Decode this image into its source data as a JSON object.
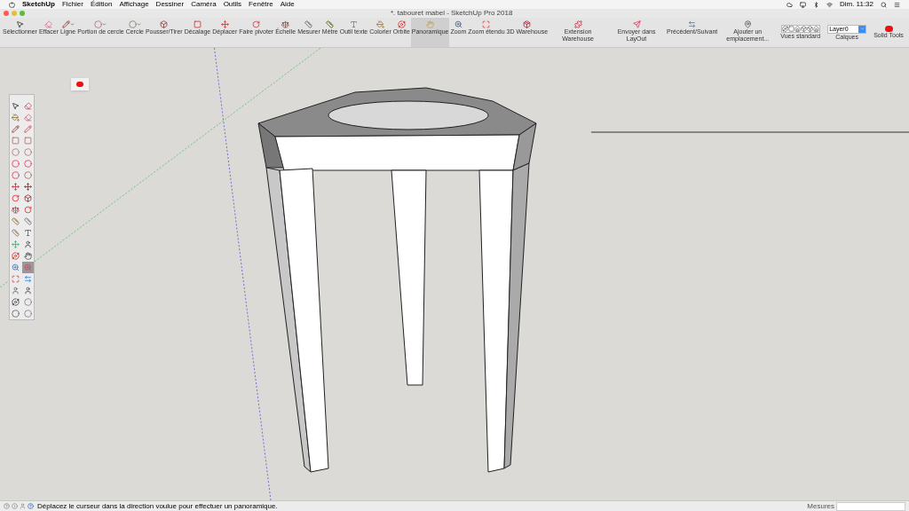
{
  "menu_bar": {
    "app": "SketchUp",
    "menus": [
      "Fichier",
      "Édition",
      "Affichage",
      "Dessiner",
      "Caméra",
      "Outils",
      "Fenêtre",
      "Aide"
    ],
    "clock": "Dim. 11:32"
  },
  "window": {
    "title": "*. tabouret mabel - SketchUp Pro 2018"
  },
  "toolbar": [
    {
      "label": "Sélectionner",
      "selected": false,
      "has_menu": false
    },
    {
      "label": "Effacer",
      "selected": false,
      "has_menu": false
    },
    {
      "label": "Ligne",
      "selected": false,
      "has_menu": true
    },
    {
      "label": "Portion de cercle",
      "selected": false,
      "has_menu": true
    },
    {
      "label": "Cercle",
      "selected": false,
      "has_menu": true
    },
    {
      "label": "Pousser/Tirer",
      "selected": false,
      "has_menu": false
    },
    {
      "label": "Décalage",
      "selected": false,
      "has_menu": false
    },
    {
      "label": "Déplacer",
      "selected": false,
      "has_menu": false
    },
    {
      "label": "Faire pivoter",
      "selected": false,
      "has_menu": false
    },
    {
      "label": "Échelle",
      "selected": false,
      "has_menu": false
    },
    {
      "label": "Mesurer",
      "selected": false,
      "has_menu": false
    },
    {
      "label": "Mètre",
      "selected": false,
      "has_menu": false
    },
    {
      "label": "Outil texte",
      "selected": false,
      "has_menu": false
    },
    {
      "label": "Colorier",
      "selected": false,
      "has_menu": false
    },
    {
      "label": "Orbite",
      "selected": false,
      "has_menu": false
    },
    {
      "label": "Panoramique",
      "selected": true,
      "has_menu": false
    },
    {
      "label": "Zoom",
      "selected": false,
      "has_menu": false
    },
    {
      "label": "Zoom étendu",
      "selected": false,
      "has_menu": false
    },
    {
      "label": "3D Warehouse",
      "selected": false,
      "has_menu": false
    },
    {
      "label": "Extension Warehouse",
      "selected": false,
      "has_menu": false
    },
    {
      "label": "Envoyer dans LayOut",
      "selected": false,
      "has_menu": false
    },
    {
      "label": "Précédent/Suivant",
      "selected": false,
      "has_menu": false
    },
    {
      "label": "Ajouter un emplacement...",
      "selected": false,
      "has_menu": false
    }
  ],
  "views": {
    "label": "Vues standard"
  },
  "layers": {
    "value": "Layer0",
    "label": "Calques"
  },
  "solid": {
    "label": "Solid Tools"
  },
  "tool_palette": [
    {
      "selected": false
    },
    {
      "selected": false
    },
    {
      "selected": false
    },
    {
      "selected": false
    },
    {
      "selected": false
    },
    {
      "selected": false
    },
    {
      "selected": false
    },
    {
      "selected": false
    },
    {
      "selected": false
    },
    {
      "selected": false
    },
    {
      "selected": false
    },
    {
      "selected": false
    },
    {
      "selected": false
    },
    {
      "selected": false
    },
    {
      "selected": false
    },
    {
      "selected": false
    },
    {
      "selected": false
    },
    {
      "selected": false
    },
    {
      "selected": false
    },
    {
      "selected": false
    },
    {
      "selected": false
    },
    {
      "selected": false
    },
    {
      "selected": false
    },
    {
      "selected": false
    },
    {
      "selected": false
    },
    {
      "selected": false
    },
    {
      "selected": false
    },
    {
      "selected": false
    },
    {
      "selected": false
    },
    {
      "selected": true
    },
    {
      "selected": false
    },
    {
      "selected": false
    },
    {
      "selected": false
    },
    {
      "selected": false
    },
    {
      "selected": false
    },
    {
      "selected": false
    },
    {
      "selected": false
    },
    {
      "selected": false
    }
  ],
  "status_bar": {
    "message": "Déplacez le curseur dans la direction voulue pour effectuer un panoramique.",
    "measure_label": "Mesures"
  }
}
